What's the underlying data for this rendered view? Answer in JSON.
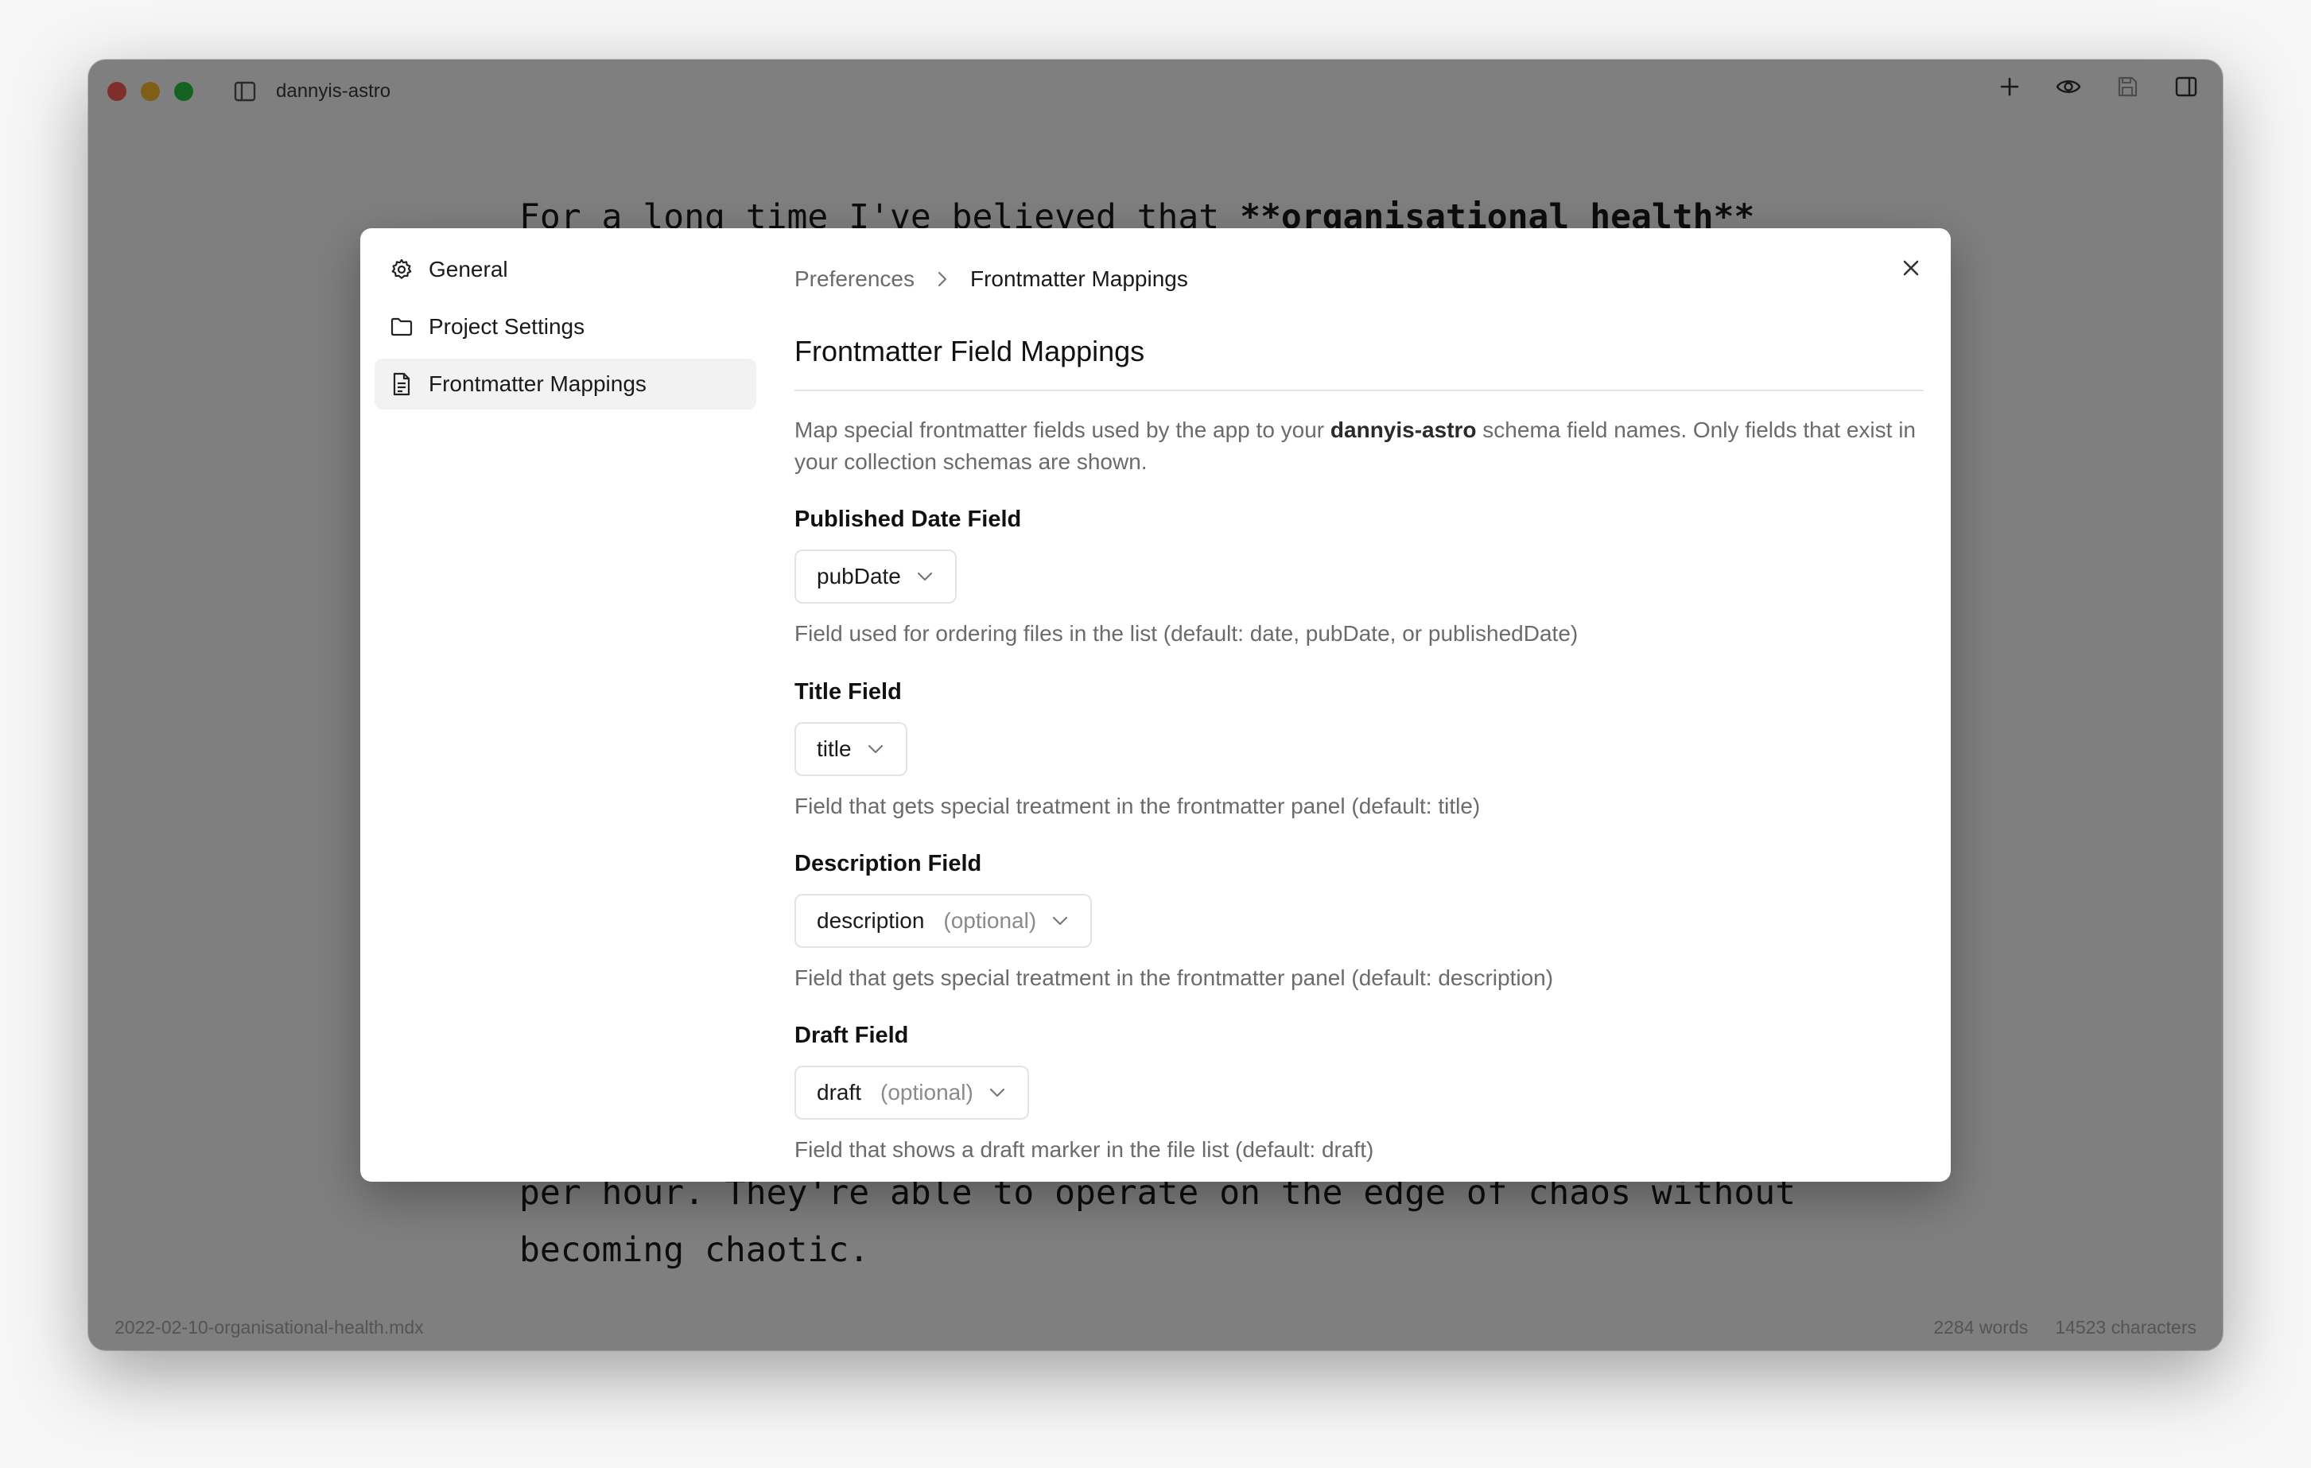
{
  "window": {
    "title": "dannyis-astro"
  },
  "editor": {
    "line1_prefix": "For a long time I've believed that ",
    "line1_bold": "**organisational health**",
    "line2": "per hour. They're able to operate on the edge of chaos without",
    "line3": "becoming chaotic."
  },
  "statusbar": {
    "filename": "2022-02-10-organisational-health.mdx",
    "words": "2284 words",
    "characters": "14523 characters"
  },
  "dialog": {
    "nav": [
      {
        "label": "General",
        "icon": "gear-icon"
      },
      {
        "label": "Project Settings",
        "icon": "folder-icon"
      },
      {
        "label": "Frontmatter Mappings",
        "icon": "document-icon",
        "active": true
      }
    ],
    "breadcrumb": {
      "root": "Preferences",
      "current": "Frontmatter Mappings"
    },
    "heading": "Frontmatter Field Mappings",
    "intro": {
      "before": "Map special frontmatter fields used by the app to your ",
      "project": "dannyis-astro",
      "after": " schema field names. Only fields that exist in your collection schemas are shown."
    },
    "fields": [
      {
        "label": "Published Date Field",
        "value": "pubDate",
        "optional": "",
        "help": "Field used for ordering files in the list (default: date, pubDate, or publishedDate)"
      },
      {
        "label": "Title Field",
        "value": "title",
        "optional": "",
        "help": "Field that gets special treatment in the frontmatter panel (default: title)"
      },
      {
        "label": "Description Field",
        "value": "description",
        "optional": "(optional)",
        "help": "Field that gets special treatment in the frontmatter panel (default: description)"
      },
      {
        "label": "Draft Field",
        "value": "draft",
        "optional": "(optional)",
        "help": "Field that shows a draft marker in the file list (default: draft)"
      }
    ]
  },
  "colors": {
    "overlay": "#00000080",
    "active_nav_bg": "#f2f2f2",
    "muted_text": "#6b6b6b"
  }
}
